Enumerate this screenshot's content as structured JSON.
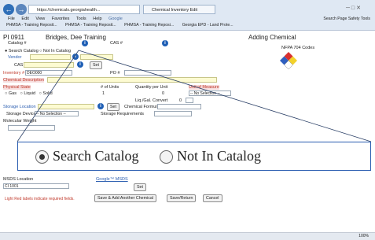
{
  "browser": {
    "url": "https://chemicals.georgiahealth...",
    "tab_title": "Chemical Inventory Edit",
    "menu": [
      "File",
      "Edit",
      "View",
      "Favorites",
      "Tools",
      "Help"
    ],
    "google_label": "Google",
    "favorites": [
      "PHMSA - Training Reposit...",
      "PHMSA - Training Reposit...",
      "PHMSA - Training Reposi...",
      "Georgia EPD - Land Prote..."
    ],
    "right_tools": "Search  Page  Safety  Tools",
    "status_zoom": "100%"
  },
  "form": {
    "pi_code": "PI 0911",
    "pi_name": "Bridges, Dee Training",
    "page_heading": "Adding Chemical",
    "nfpa_label": "NFPA 704 Codes",
    "catalog_label": "Catalog #",
    "cas_label": "CAS #",
    "radio_search": "Search Catalog",
    "radio_not_in": "Not In Catalog",
    "vendor_label": "Vendor",
    "cas_field_label": "CAS",
    "set_label": "Set",
    "inventory_label": "Inventory #",
    "inventory_value": "DEO000",
    "po_label": "PO #",
    "chem_desc_label": "Chemical Description",
    "physical_state_label": "Physical State",
    "units_label": "# of Units",
    "qty_per_unit_label": "Quantity per Unit",
    "unit_label": "Unit of Measure",
    "state_gas": "Gas",
    "state_liquid": "Liquid",
    "state_solid": "Solid",
    "units_value": "1",
    "qty_value": "0",
    "no_selection": "-- No Selection --",
    "liq_gal_label": "Liq./Gal. Convert",
    "liq_gal_value": "0",
    "storage_location_label": "Storage Location",
    "chemical_formula_label": "Chemical Formula",
    "storage_device_label": "Storage Device",
    "storage_req_label": "Storage Requirements",
    "molecular_weight_label": "Molecular Weight",
    "msds_location_label": "MSDS Location",
    "google_msds": "Google™ MSDS",
    "ci_value": "CI 1001",
    "footnote": "Light Red labels indicate required fields.",
    "btn_save_add": "Save & Add Another Chemical",
    "btn_save_return": "Save/Return",
    "btn_cancel": "Cancel"
  }
}
